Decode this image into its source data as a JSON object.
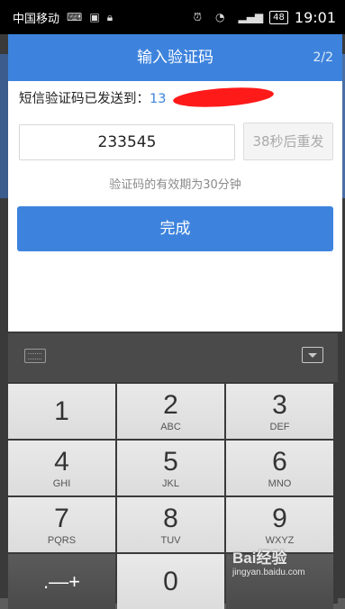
{
  "status_bar": {
    "carrier": "中国移动",
    "time": "19:01",
    "battery": "48",
    "icons": [
      "keyboard-icon",
      "image-icon",
      "lock-icon",
      "alarm-icon",
      "wifi-icon",
      "signal-icon",
      "battery-icon"
    ]
  },
  "dialog": {
    "title": "输入验证码",
    "step": "2/2",
    "sent_label": "短信验证码已发送到：",
    "sent_phone": "13",
    "code_value": "233545",
    "resend_label": "38秒后重发",
    "validity_note": "验证码的有效期为30分钟",
    "done_label": "完成"
  },
  "keyboard": {
    "toolbar_icons": [
      "keyboard-switch-icon",
      "hide-keyboard-icon"
    ],
    "keys": [
      {
        "num": "1",
        "letters": ""
      },
      {
        "num": "2",
        "letters": "ABC"
      },
      {
        "num": "3",
        "letters": "DEF"
      },
      {
        "num": "4",
        "letters": "GHI"
      },
      {
        "num": "5",
        "letters": "JKL"
      },
      {
        "num": "6",
        "letters": "MNO"
      },
      {
        "num": "7",
        "letters": "PQRS"
      },
      {
        "num": "8",
        "letters": "TUV"
      },
      {
        "num": "9",
        "letters": "WXYZ"
      },
      {
        "num": ".—+",
        "letters": ""
      },
      {
        "num": "0",
        "letters": ""
      },
      {
        "num": "",
        "letters": ""
      }
    ]
  },
  "watermark": {
    "logo": "Bai经验",
    "url": "jingyan.baidu.com"
  },
  "colors": {
    "accent": "#3d83dd",
    "redaction": "#ff1a1a"
  }
}
